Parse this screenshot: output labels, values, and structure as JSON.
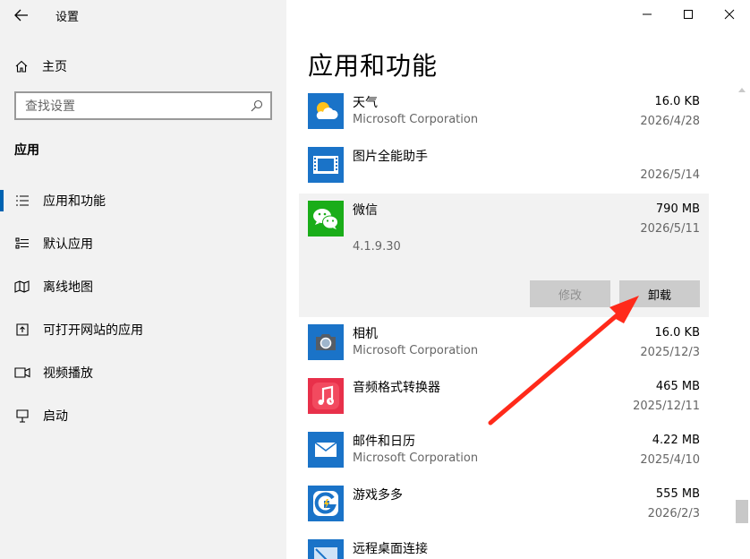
{
  "window": {
    "title": "设置",
    "back_icon": "back-arrow-icon",
    "controls": [
      "minimize-icon",
      "maximize-icon",
      "close-icon"
    ]
  },
  "sidebar": {
    "home_label": "主页",
    "search_placeholder": "查找设置",
    "section": "应用",
    "items": [
      {
        "label": "应用和功能",
        "icon": "apps-features-icon",
        "selected": true
      },
      {
        "label": "默认应用",
        "icon": "default-apps-icon",
        "selected": false
      },
      {
        "label": "离线地图",
        "icon": "offline-maps-icon",
        "selected": false
      },
      {
        "label": "可打开网站的应用",
        "icon": "apps-for-websites-icon",
        "selected": false
      },
      {
        "label": "视频播放",
        "icon": "video-playback-icon",
        "selected": false
      },
      {
        "label": "启动",
        "icon": "startup-icon",
        "selected": false
      }
    ]
  },
  "main": {
    "title": "应用和功能",
    "apps": [
      {
        "name": "天气",
        "publisher": "Microsoft Corporation",
        "size": "16.0 KB",
        "date": "2026/4/28",
        "icon": "weather-icon"
      },
      {
        "name": "图片全能助手",
        "publisher": "",
        "size": "",
        "date": "2026/5/14",
        "icon": "image-tool-icon"
      },
      {
        "name": "微信",
        "publisher": "",
        "size": "790 MB",
        "date": "2026/5/11",
        "version": "4.1.9.30",
        "icon": "wechat-icon",
        "expanded": true,
        "modify_label": "修改",
        "uninstall_label": "卸载"
      },
      {
        "name": "相机",
        "publisher": "Microsoft Corporation",
        "size": "16.0 KB",
        "date": "2025/12/3",
        "icon": "camera-icon"
      },
      {
        "name": "音频格式转换器",
        "publisher": "",
        "size": "465 MB",
        "date": "2025/12/11",
        "icon": "audio-converter-icon"
      },
      {
        "name": "邮件和日历",
        "publisher": "Microsoft Corporation",
        "size": "4.22 MB",
        "date": "2025/4/10",
        "icon": "mail-icon"
      },
      {
        "name": "游戏多多",
        "publisher": "",
        "size": "555 MB",
        "date": "2026/2/3",
        "icon": "game-icon"
      },
      {
        "name": "远程桌面连接",
        "publisher": "",
        "size": "",
        "date": "",
        "icon": "remote-desktop-icon"
      }
    ]
  },
  "colors": {
    "accent": "#0063b1",
    "sidebar_bg": "#f2f2f2",
    "annotation_arrow": "#ff2a1a"
  }
}
